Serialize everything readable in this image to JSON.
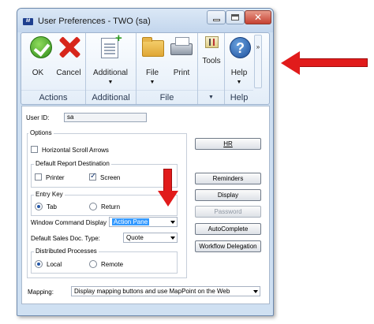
{
  "window": {
    "title": "User Preferences  -  TWO (sa)",
    "app_icon_text": "M"
  },
  "ribbon": {
    "actions": {
      "label": "Actions",
      "ok": "OK",
      "cancel": "Cancel"
    },
    "additional": {
      "label": "Additional",
      "additional": "Additional"
    },
    "file": {
      "label": "File",
      "file": "File",
      "print": "Print"
    },
    "tools": {
      "tools": "Tools"
    },
    "help": {
      "label": "Help",
      "help": "Help",
      "help_glyph": "?"
    },
    "more": "»",
    "dropdown_glyph": "▼"
  },
  "form": {
    "user_id_label": "User ID:",
    "user_id_value": "sa",
    "options_label": "Options",
    "horizontal_scroll_arrows": "Horizontal Scroll Arrows",
    "default_report_destination": "Default Report Destination",
    "printer": "Printer",
    "screen": "Screen",
    "entry_key": "Entry Key",
    "tab": "Tab",
    "return": "Return",
    "window_command_display_label": "Window Command Display",
    "window_command_display_value": "Action Pane",
    "default_sales_doc_type_label": "Default Sales Doc. Type:",
    "default_sales_doc_type_value": "Quote",
    "distributed_processes": "Distributed Processes",
    "local": "Local",
    "remote": "Remote",
    "mapping_label": "Mapping:",
    "mapping_value": "Display mapping buttons and use MapPoint on the Web"
  },
  "buttons": {
    "hr": "HR",
    "reminders": "Reminders",
    "display": "Display",
    "password": "Password",
    "autocomplete": "AutoComplete",
    "workflow_delegation": "Workflow Delegation"
  },
  "state": {
    "horizontal_scroll_arrows_checked": false,
    "printer_checked": false,
    "screen_checked": true,
    "entry_key_selected": "Tab",
    "distributed_processes_selected": "Local",
    "password_enabled": false
  },
  "colors": {
    "annotation_arrow": "#e11b1b",
    "selection_highlight": "#3399ff"
  }
}
